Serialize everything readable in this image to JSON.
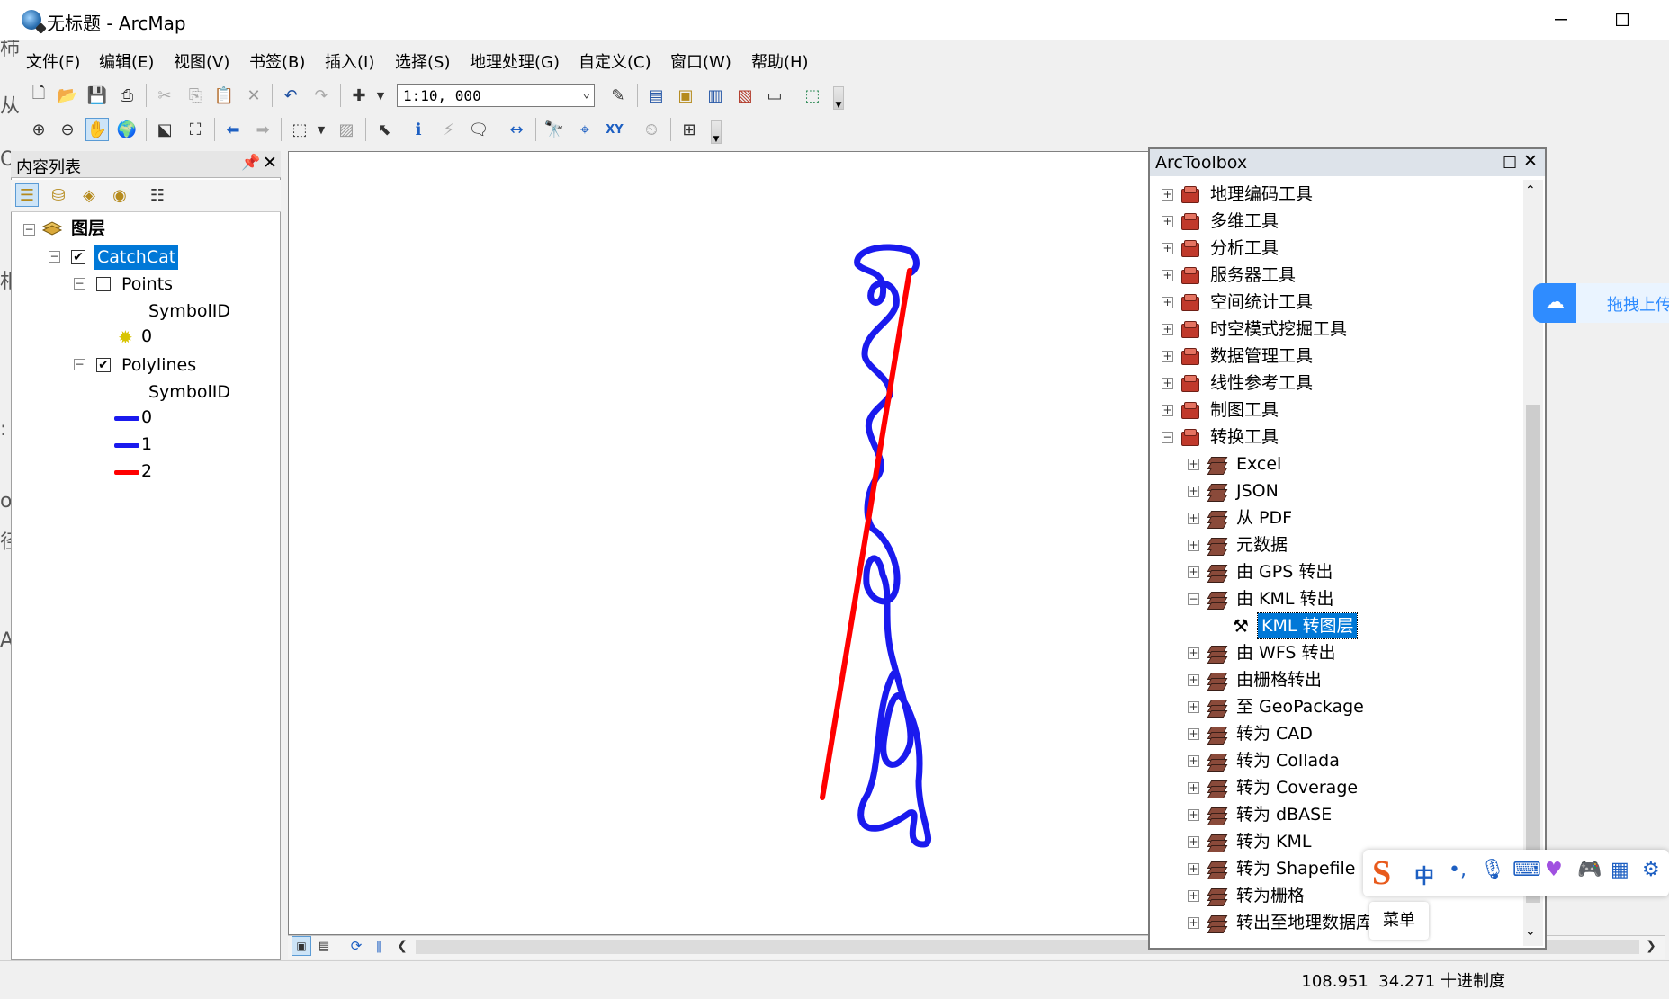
{
  "window": {
    "title": "无标题 - ArcMap"
  },
  "menu": [
    "文件(F)",
    "编辑(E)",
    "视图(V)",
    "书签(B)",
    "插入(I)",
    "选择(S)",
    "地理处理(G)",
    "自定义(C)",
    "窗口(W)",
    "帮助(H)"
  ],
  "toolbar": {
    "scale": "1:10, 000"
  },
  "toc": {
    "title": "内容列表",
    "root": "图层",
    "group": "CatchCat",
    "points": {
      "label": "Points",
      "field": "SymbolID",
      "value": "0"
    },
    "polylines": {
      "label": "Polylines",
      "field": "SymbolID",
      "values": [
        "0",
        "1",
        "2"
      ]
    }
  },
  "colors": {
    "blue_line": "#1a1aee",
    "red_line": "#ff0000",
    "selected": "#0078d7"
  },
  "arctoolbox": {
    "title": "ArcToolbox",
    "toolboxes": [
      "地理编码工具",
      "多维工具",
      "分析工具",
      "服务器工具",
      "空间统计工具",
      "时空模式挖掘工具",
      "数据管理工具",
      "线性参考工具",
      "制图工具",
      "转换工具"
    ],
    "toolsets": [
      "Excel",
      "JSON",
      "从 PDF",
      "元数据",
      "由 GPS 转出",
      "由 KML 转出"
    ],
    "kml_tool": "KML 转图层",
    "toolsets_after": [
      "由 WFS 转出",
      "由栅格转出",
      "至 GeoPackage",
      "转为 CAD",
      "转为 Collada",
      "转为 Coverage",
      "转为 dBASE",
      "转为 KML",
      "转为 Shapefile",
      "转为栅格",
      "转出至地理数据库"
    ]
  },
  "status": {
    "x": "108.951",
    "y": "34.271",
    "units": "十进制度"
  },
  "ime": {
    "lang": "中",
    "menu": "菜单"
  },
  "baidu": {
    "label": "拖拽上传"
  }
}
